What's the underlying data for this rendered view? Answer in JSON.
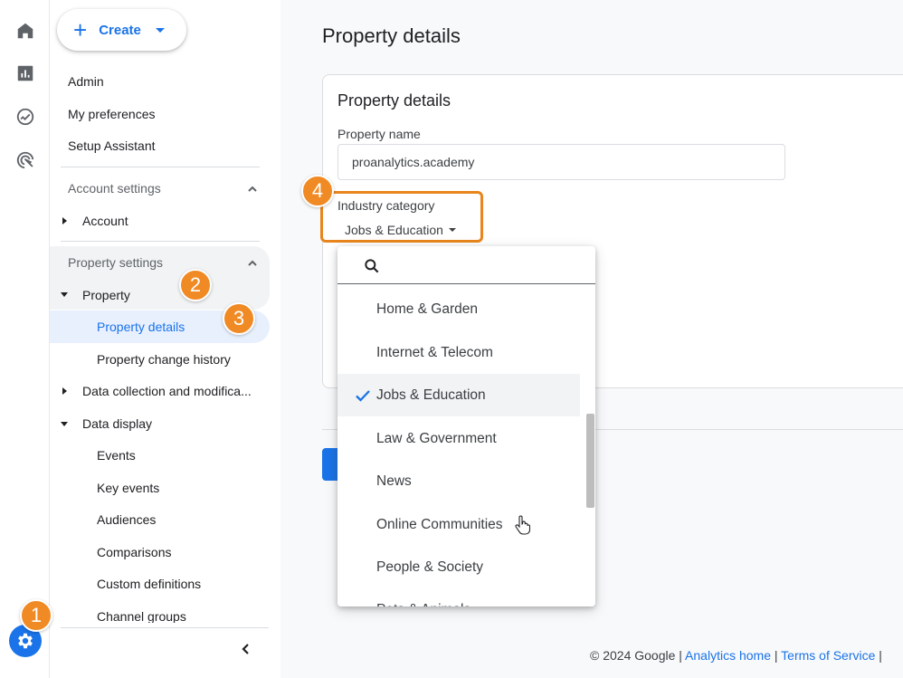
{
  "rail": {
    "icons": [
      "home-icon",
      "reports-icon",
      "explore-icon",
      "advertising-icon"
    ],
    "admin_icon": "gear-icon"
  },
  "create": {
    "label": "Create"
  },
  "nav": {
    "admin": "Admin",
    "my_preferences": "My preferences",
    "setup_assistant": "Setup Assistant",
    "account_settings": "Account settings",
    "account": "Account",
    "property_settings": "Property settings",
    "property": "Property",
    "property_details": "Property details",
    "property_change_history": "Property change history",
    "data_collection": "Data collection and modifica...",
    "data_display": "Data display",
    "events": "Events",
    "key_events": "Key events",
    "audiences": "Audiences",
    "comparisons": "Comparisons",
    "custom_definitions": "Custom definitions",
    "channel_groups": "Channel groups"
  },
  "main": {
    "page_title": "Property details",
    "card_title": "Property details",
    "property_name_label": "Property name",
    "property_name_value": "proanalytics.academy",
    "industry_label": "Industry category",
    "industry_value": "Jobs & Education"
  },
  "dropdown": {
    "items": [
      "Home & Garden",
      "Internet & Telecom",
      "Jobs & Education",
      "Law & Government",
      "News",
      "Online Communities",
      "People & Society",
      "Pets & Animals"
    ],
    "selected": "Jobs & Education"
  },
  "footer": {
    "copyright": "© 2024 Google",
    "sep": "|",
    "analytics_home": "Analytics home",
    "terms": "Terms of Service"
  },
  "badges": [
    "1",
    "2",
    "3",
    "4"
  ],
  "colors": {
    "accent": "#1a73e8",
    "badge": "#f08a24",
    "highlight": "#e8851c"
  }
}
